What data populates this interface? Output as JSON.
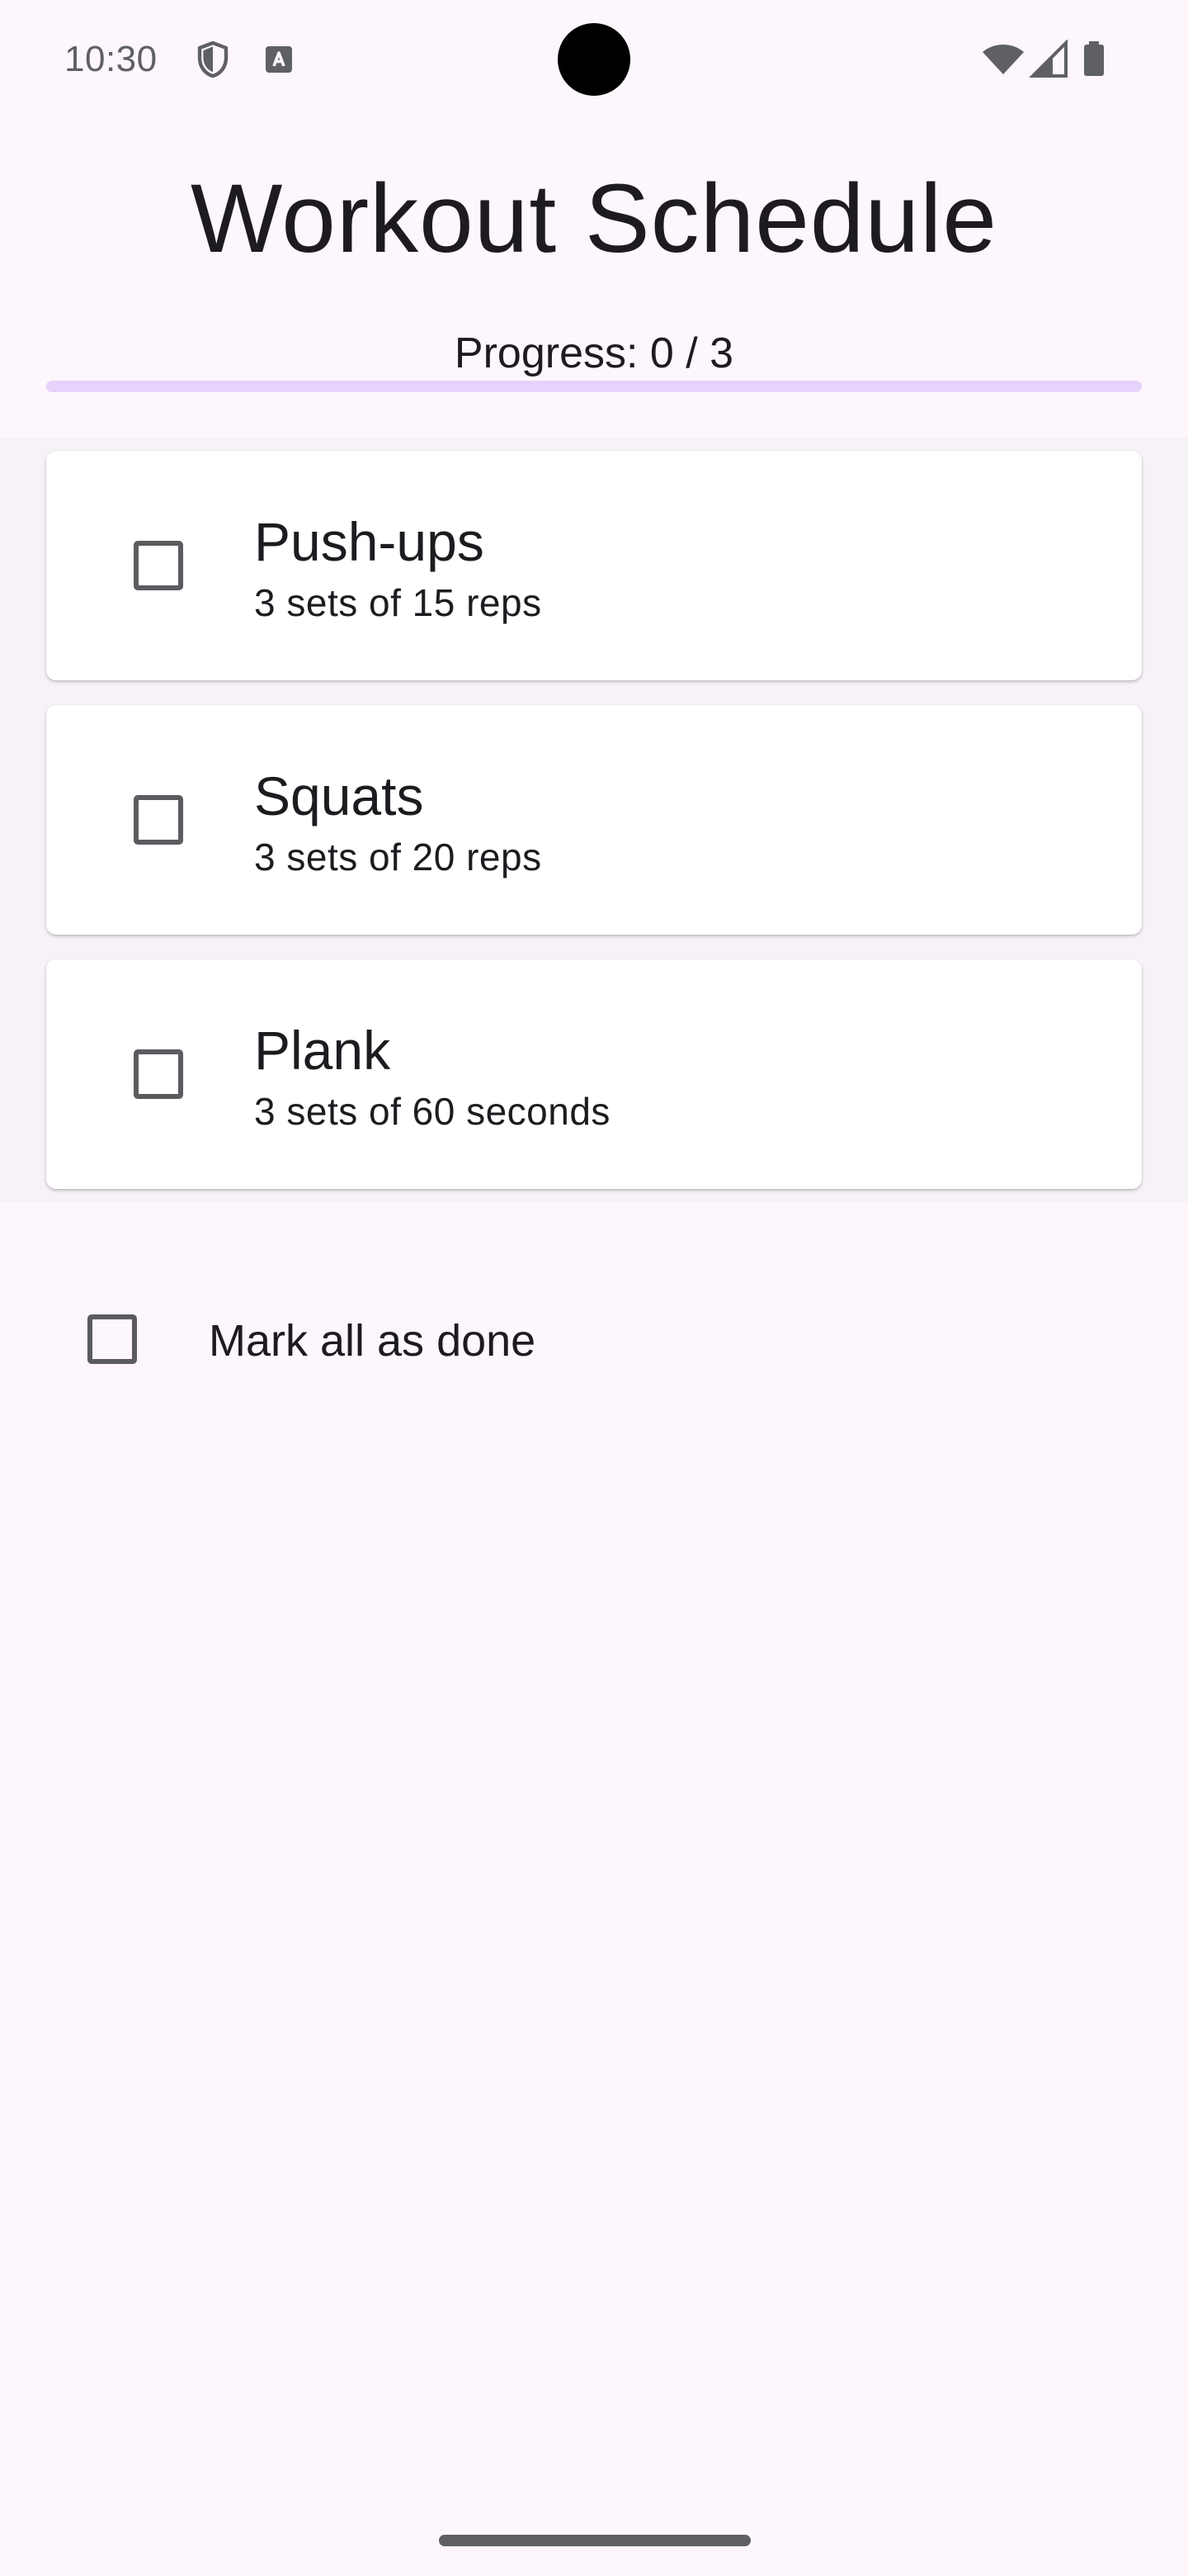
{
  "status_bar": {
    "time": "10:30",
    "left_icons": [
      "shield-icon",
      "font-a-icon"
    ],
    "right_icons": [
      "wifi-icon",
      "signal-icon",
      "battery-icon"
    ]
  },
  "title": "Workout Schedule",
  "progress": {
    "label": "Progress: 0 / 3",
    "completed": 0,
    "total": 3,
    "fraction": 0
  },
  "exercises": [
    {
      "name": "Push-ups",
      "detail": "3 sets of 15 reps",
      "checked": false
    },
    {
      "name": "Squats",
      "detail": "3 sets of 20 reps",
      "checked": false
    },
    {
      "name": "Plank",
      "detail": "3 sets of 60 seconds",
      "checked": false
    }
  ],
  "mark_all": {
    "label": "Mark all as done",
    "checked": false
  },
  "colors": {
    "background": "#fdf6fc",
    "progress_track": "#e6d3fb",
    "progress_fill": "#6750a4",
    "checkbox_border": "#5c5c60",
    "text": "#1d1b20"
  }
}
